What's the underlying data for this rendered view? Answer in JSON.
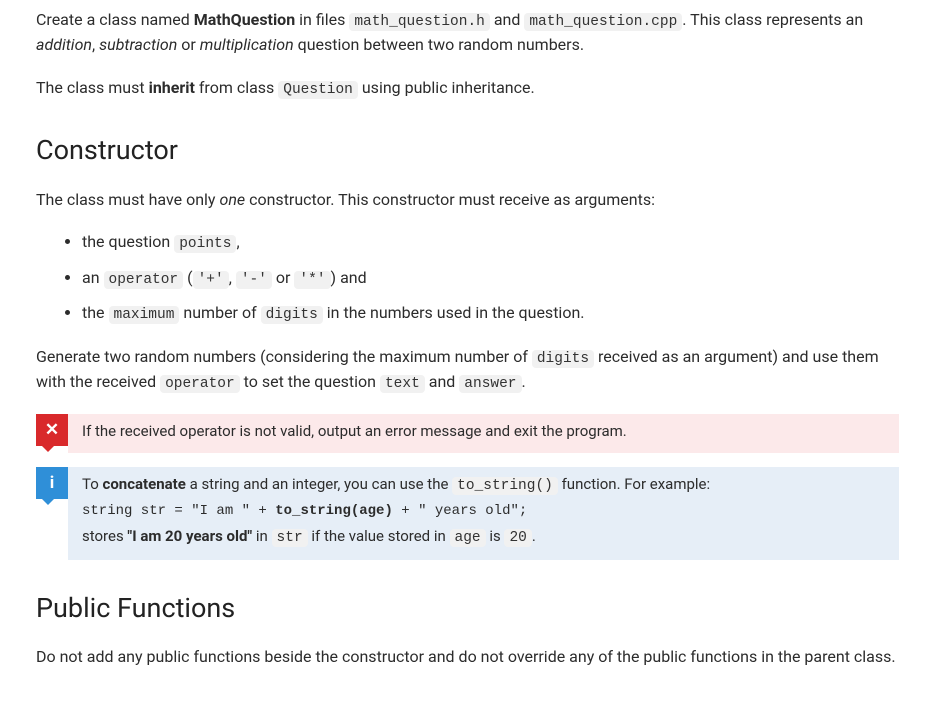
{
  "intro": {
    "p1_prefix": "Create a class named ",
    "p1_classname": "MathQuestion",
    "p1_mid1": " in files ",
    "p1_file1": "math_question.h",
    "p1_and": " and ",
    "p1_file2": "math_question.cpp",
    "p1_mid2": ". This class represents an ",
    "p1_em1": "addition",
    "p1_comma1": ", ",
    "p1_em2": "subtraction",
    "p1_or": " or ",
    "p1_em3": "multiplication",
    "p1_suffix": " question between two random numbers.",
    "p2_prefix": "The class must ",
    "p2_inherit": "inherit",
    "p2_mid": " from class ",
    "p2_code": "Question",
    "p2_suffix": " using public inheritance."
  },
  "constructor": {
    "heading": "Constructor",
    "p1_prefix": "The class must have only ",
    "p1_em": "one",
    "p1_suffix": " constructor. This constructor must receive as arguments:",
    "li1_prefix": "the question ",
    "li1_code": "points",
    "li1_suffix": ",",
    "li2_prefix": "an ",
    "li2_code1": "operator",
    "li2_open": " (",
    "li2_op1": "'+'",
    "li2_c1": ", ",
    "li2_op2": "'-'",
    "li2_or": " or ",
    "li2_op3": "'*'",
    "li2_close": ") and",
    "li3_prefix": "the ",
    "li3_code1": "maximum",
    "li3_mid": " number of ",
    "li3_code2": "digits",
    "li3_suffix": " in the numbers used in the question.",
    "p2_prefix": "Generate two random numbers (considering the maximum number of ",
    "p2_code1": "digits",
    "p2_mid1": " received as an argument) and use them with the received ",
    "p2_code2": "operator",
    "p2_mid2": " to set the question ",
    "p2_code3": "text",
    "p2_and": " and ",
    "p2_code4": "answer",
    "p2_suffix": "."
  },
  "error_callout": {
    "icon": "✕",
    "text": "If the received operator is not valid, output an error message and exit the program."
  },
  "info_callout": {
    "icon": "i",
    "l1_prefix": "To ",
    "l1_b1": "concatenate",
    "l1_mid": " a string and an integer, you can use the ",
    "l1_code": "to_string()",
    "l1_suffix": " function. For example:",
    "code_line_pre": "string str = \"I am \" + ",
    "code_line_bold": "to_string(age)",
    "code_line_post": " + \" years old\";",
    "l3_prefix": "stores ",
    "l3_b": "\"I am 20 years old\"",
    "l3_mid": " in ",
    "l3_code1": "str",
    "l3_mid2": " if the value stored in ",
    "l3_code2": "age",
    "l3_mid3": " is ",
    "l3_code3": "20",
    "l3_suffix": "."
  },
  "public_functions": {
    "heading": "Public Functions",
    "p1": "Do not add any public functions beside the constructor and do not override any of the public functions in the parent class."
  }
}
